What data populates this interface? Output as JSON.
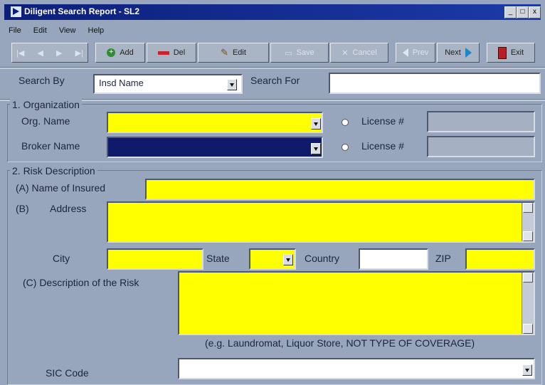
{
  "window": {
    "title": "Diligent Search Report - SL2",
    "min": "_",
    "max": "□",
    "close": "x"
  },
  "menu": [
    "File",
    "Edit",
    "View",
    "Help"
  ],
  "toolbar": {
    "first": "|◀",
    "prev_rec": "◀",
    "next_rec": "▶",
    "last": "▶|",
    "add": "Add",
    "del": "Del",
    "edit": "Edit",
    "save": "Save",
    "cancel": "Cancel",
    "prev": "Prev",
    "next": "Next",
    "exit": "Exit"
  },
  "search": {
    "by_label": "Search By",
    "by_value": "Insd Name",
    "for_label": "Search For",
    "for_value": ""
  },
  "org": {
    "section": "1. Organization",
    "org_name_label": "Org. Name",
    "broker_label": "Broker Name",
    "license_label": "License #",
    "license2_label": "License #"
  },
  "risk": {
    "section": "2. Risk Description",
    "insured_label": "(A) Name of Insured",
    "b_label": "(B)",
    "address_label": "Address",
    "city_label": "City",
    "state_label": "State",
    "country_label": "Country",
    "zip_label": "ZIP",
    "desc_label": "(C) Description of the Risk",
    "hint": "(e.g. Laundromat, Liquor Store, NOT TYPE OF COVERAGE)",
    "sic_label": "SIC Code"
  },
  "colors": {
    "required_field": "#ffff00",
    "selected_field": "#101a6b",
    "panel": "#97a6bd",
    "title_bar": "#0c1f7a"
  }
}
